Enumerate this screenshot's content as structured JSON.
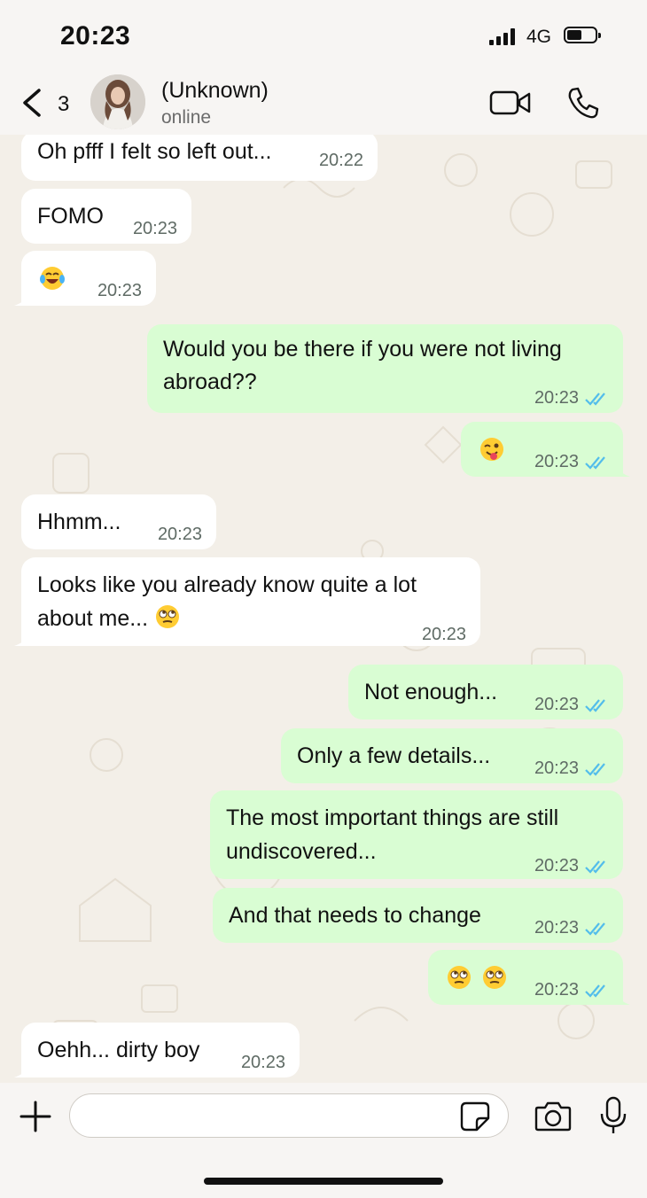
{
  "status_bar": {
    "time": "20:23",
    "network": "4G"
  },
  "header": {
    "back_count": "3",
    "contact_name": "(Unknown)",
    "contact_status": "online"
  },
  "messages": [
    {
      "dir": "in",
      "text": "Oh pfff I felt so left out...",
      "time": "20:22"
    },
    {
      "dir": "in",
      "text": "FOMO",
      "time": "20:23"
    },
    {
      "dir": "in",
      "emoji": [
        "tears-of-joy"
      ],
      "time": "20:23"
    },
    {
      "dir": "out",
      "lines": [
        "Would you be there if you were not living",
        "abroad??"
      ],
      "time": "20:23",
      "read": true
    },
    {
      "dir": "out",
      "emoji": [
        "winking-tongue"
      ],
      "time": "20:23",
      "read": true
    },
    {
      "dir": "in",
      "text": "Hhmm...",
      "time": "20:23"
    },
    {
      "dir": "in",
      "lines": [
        "Looks like you already know quite a lot",
        "about me..."
      ],
      "emoji": [
        "face-with-rolling-eyes"
      ],
      "time": "20:23"
    },
    {
      "dir": "out",
      "text": "Not enough...",
      "time": "20:23",
      "read": true
    },
    {
      "dir": "out",
      "text": "Only a few details...",
      "time": "20:23",
      "read": true
    },
    {
      "dir": "out",
      "lines": [
        "The most important things are still",
        "undiscovered..."
      ],
      "time": "20:23",
      "read": true
    },
    {
      "dir": "out",
      "text": "And that needs to change",
      "time": "20:23",
      "read": true
    },
    {
      "dir": "out",
      "emoji": [
        "face-with-rolling-eyes",
        "face-with-rolling-eyes"
      ],
      "time": "20:23",
      "read": true
    },
    {
      "dir": "in",
      "text": "Oehh... dirty boy",
      "time": "20:23"
    }
  ],
  "input": {
    "placeholder": ""
  },
  "colors": {
    "incoming": "#ffffff",
    "outgoing": "#d9fdd3",
    "read_ticks": "#53bdeb",
    "wallpaper": "#f3efe8"
  },
  "icons": [
    "back-chevron-icon",
    "video-call-icon",
    "phone-icon",
    "plus-icon",
    "sticker-icon",
    "camera-icon",
    "microphone-icon"
  ]
}
